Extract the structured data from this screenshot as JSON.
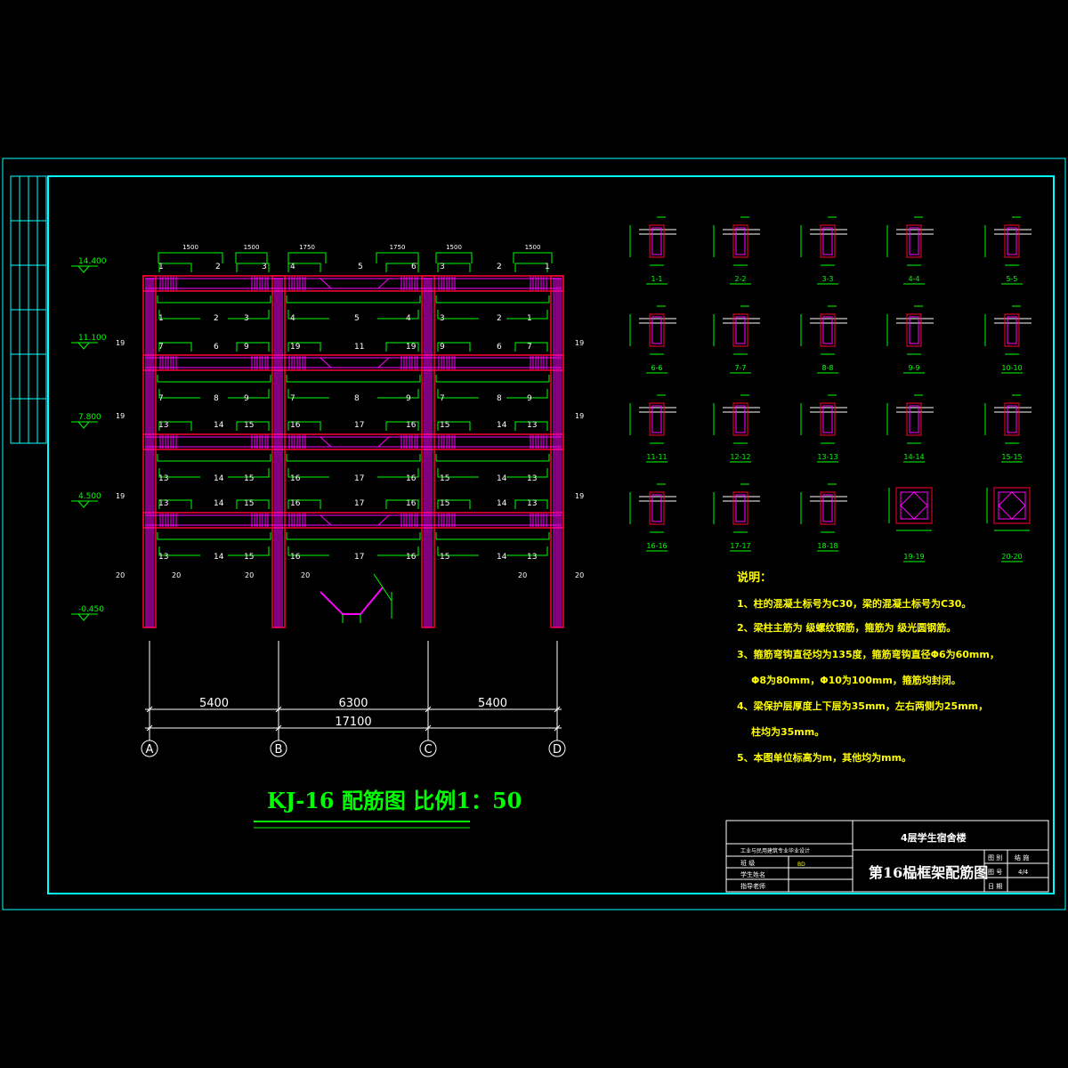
{
  "drawing": {
    "title": "KJ-16  配筋图  比例1：50",
    "colors": {
      "background": "#000000",
      "frame": "#00ffff",
      "concrete": "#ff0033",
      "rebar": "#ff00ff",
      "dimension": "#00ff00",
      "text": "#ffffff",
      "notes": "#ffff00"
    }
  },
  "elevations": [
    "14.400",
    "11.100",
    "7.800",
    "4.500",
    "-0.450"
  ],
  "axes": [
    "A",
    "B",
    "C",
    "D"
  ],
  "spans": [
    "5400",
    "6300",
    "5400"
  ],
  "total_span": "17100",
  "top_dims": [
    "1500",
    "1500",
    "1750",
    "1750",
    "1500",
    "1500"
  ],
  "bar_marks": [
    "1",
    "2",
    "3",
    "4",
    "5",
    "6",
    "7",
    "8",
    "9",
    "11",
    "13",
    "14",
    "15",
    "16",
    "17",
    "19",
    "20"
  ],
  "section_labels": [
    "1-1",
    "2-2",
    "3-3",
    "4-4",
    "5-5",
    "6-6",
    "7-7",
    "8-8",
    "9-9",
    "10-10",
    "11-11",
    "12-12",
    "13-13",
    "14-14",
    "15-15",
    "16-16",
    "17-17",
    "18-18",
    "19-19",
    "20-20"
  ],
  "notes": {
    "heading": "说明：",
    "items": [
      "1、柱的混凝土标号为C30，梁的混凝土标号为C30。",
      "2、梁柱主筋为 级螺纹钢筋，箍筋为 级光圆钢筋。",
      "3、箍筋弯钩直径均为135度，箍筋弯钩直径Φ6为60mm，",
      "Φ8为80mm，Φ10为100mm，箍筋均封闭。",
      "4、梁保护层厚度上下层为35mm，左右两侧为25mm，",
      "柱均为35mm。",
      "5、本图单位标高为m，其他均为mm。"
    ]
  },
  "title_block": {
    "school": "工业与民用建筑专业毕业设计",
    "project": "4层学生宿舍楼",
    "sheet_title": "第16榀框架配筋图",
    "row1": "班 级",
    "row2": "学生姓名",
    "row3": "指导老师",
    "student_value": "BD",
    "label_sheet": "图 别",
    "value_sheet": "结 施",
    "label_no": "图 号",
    "value_no": "4/4",
    "label_date": "日 期"
  }
}
